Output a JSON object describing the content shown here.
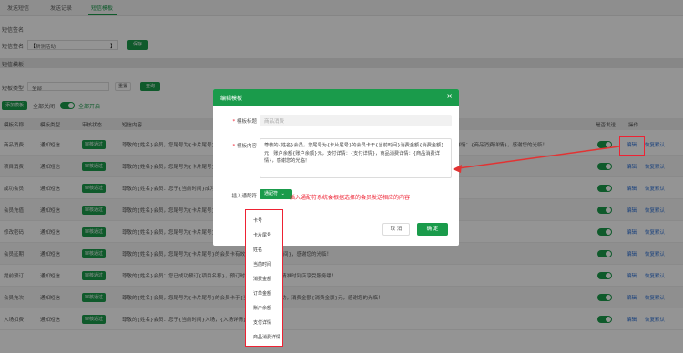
{
  "tabs": [
    {
      "label": "发送短信"
    },
    {
      "label": "发送记录"
    },
    {
      "label": "短信模板"
    }
  ],
  "signature": {
    "section_title": "短信签名",
    "label": "短信签名：",
    "value": "新测活动",
    "bracket_left": "【",
    "bracket_right": "】",
    "save_button": "保存"
  },
  "template_section": {
    "title": "短信模板",
    "type_label": "短板类型",
    "type_value": "全部",
    "reset_button": "重置",
    "query_button": "查询",
    "add_button": "添加模板",
    "close_all_label": "全部关闭",
    "open_all_label": "全部开启"
  },
  "table": {
    "headers": [
      "模板名称",
      "模板类型",
      "审核状态",
      "短信内容",
      "是否发送",
      "操作"
    ],
    "rows": [
      {
        "name": "商品消费",
        "type": "通知短信",
        "status": "审核通过",
        "content": "尊敬的{姓名}会员，您尾号为{卡片尾号}的会员卡于{当前时间}消费金额{消费金额}元，账户余额{账户余额}元，支付详情：{支付详情}，商品消费详情：{商品消费详情}，感谢您的光临！",
        "edit": "编辑",
        "restore": "恢复默认"
      },
      {
        "name": "项目消费",
        "type": "通知短信",
        "status": "审核通过",
        "content": "尊敬的{姓名}会员，您尾号为{卡片尾号}的会员卡于{当前时间}消费金额{消费金额}元，感谢您的光临！",
        "edit": "编辑",
        "restore": "恢复默认"
      },
      {
        "name": "成功会员",
        "type": "通知短信",
        "status": "审核通过",
        "content": "尊敬的{姓名}会员：您于{当前时间}成为我们的会员，会员卡号{卡号}，{过期时间}，感谢您的光临！",
        "edit": "编辑",
        "restore": "恢复默认"
      },
      {
        "name": "会员充值",
        "type": "通知短信",
        "status": "审核通过",
        "content": "尊敬的{姓名}会员，您尾号为{卡片尾号}的会员卡于{当前时间}充值成功，感谢您的光临！",
        "edit": "编辑",
        "restore": "恢复默认"
      },
      {
        "name": "修改密码",
        "type": "通知短信",
        "status": "审核通过",
        "content": "尊敬的{姓名}会员，您尾号为{卡片尾号}的会员卡密码已修改，感谢您的光临！",
        "edit": "编辑",
        "restore": "恢复默认"
      },
      {
        "name": "会员延期",
        "type": "通知短信",
        "status": "审核通过",
        "content": "尊敬的{姓名}会员，您尾号为{卡片尾号}的会员卡有效期延至{新到期时间}，感谢您的光临！",
        "edit": "编辑",
        "restore": "恢复默认"
      },
      {
        "name": "提前预订",
        "type": "通知短信",
        "status": "审核通过",
        "content": "尊敬的{姓名}会员：您已成功预订{项目名称}，预订时间{预订时间}，请准时到店享受服务哦！",
        "edit": "编辑",
        "restore": "恢复默认"
      },
      {
        "name": "会员充次",
        "type": "通知短信",
        "status": "审核通过",
        "content": "尊敬的{姓名}会员，您尾号为{卡片尾号}的会员卡于{当前时间}充次成功，消费金额{消费金额}元，感谢您的光临！",
        "edit": "编辑",
        "restore": "恢复默认"
      },
      {
        "name": "入场扣费",
        "type": "通知短信",
        "status": "审核通过",
        "content": "尊敬的{姓名}会员：您于{当前时间}入场，{入场详情}，感谢您的光临！",
        "edit": "编辑",
        "restore": "恢复默认"
      }
    ]
  },
  "modal": {
    "title": "编辑模板",
    "close_icon": "×",
    "name_label": "模板标题",
    "name_placeholder": "商品消费",
    "content_label": "模板内容",
    "content_text": "尊敬的{姓名}会员，您尾号为{卡片尾号}的会员卡于{当前时间}消费金额{消费金额}元，账户余额{账户余额}元，支付详情：{支付详情}，商品消费详情：{商品消费详情}，感谢您的光临！",
    "insert_label": "插入通配符",
    "insert_button": "通配符",
    "insert_hint": "插入通配符系统会根据选择的会员发送相应的内容",
    "cancel_button": "取 消",
    "ok_button": "确 定"
  },
  "wildcards": [
    "卡号",
    "卡片尾号",
    "姓名",
    "当前时间",
    "消费金额",
    "订单金额",
    "账户余额",
    "支付详情",
    "商品消费详情"
  ],
  "colors": {
    "accent": "#1a9b4b",
    "annotation": "#e23333"
  }
}
